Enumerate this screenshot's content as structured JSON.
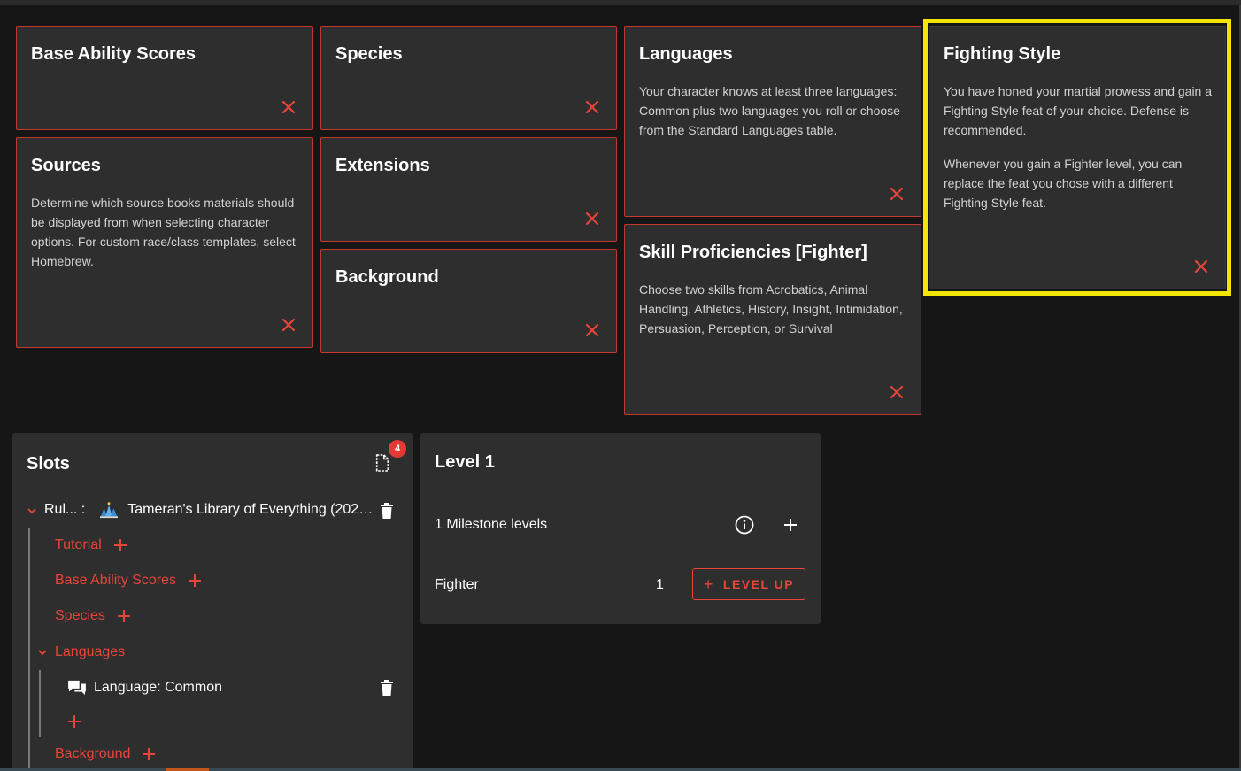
{
  "cards": {
    "base_ability": {
      "title": "Base Ability Scores"
    },
    "species": {
      "title": "Species"
    },
    "languages": {
      "title": "Languages",
      "desc": "Your character knows at least three languages: Common plus two languages you roll or choose from the Standard Languages table."
    },
    "fighting_style": {
      "title": "Fighting Style",
      "desc1": "You have honed your martial prowess and gain a Fighting Style feat of your choice. Defense is recommended.",
      "desc2": "Whenever you gain a Fighter level, you can replace the feat you chose with a different Fighting Style feat."
    },
    "sources": {
      "title": "Sources",
      "desc": "Determine which source books materials should be displayed from when selecting character options. For custom race/class templates, select Homebrew."
    },
    "extensions": {
      "title": "Extensions"
    },
    "background": {
      "title": "Background"
    },
    "skills": {
      "title": "Skill Proficiencies [Fighter]",
      "desc": "Choose two skills from Acrobatics, Animal Handling, Athletics, History, Insight, Intimidation, Persuasion, Perception, or Survival"
    }
  },
  "slots": {
    "title": "Slots",
    "badge": "4",
    "ruleset_label": "Rul... :",
    "ruleset_value": "Tameran's Library of Everything (2024...",
    "items": {
      "tutorial": "Tutorial",
      "base_ability": "Base Ability Scores",
      "species": "Species",
      "languages": "Languages",
      "language_common": "Language: Common",
      "background": "Background"
    }
  },
  "level": {
    "title": "Level 1",
    "milestone": "1 Milestone levels",
    "class_name": "Fighter",
    "class_level": "1",
    "level_up": "LEVEL UP"
  },
  "colors": {
    "accent": "#e8453a",
    "highlight": "#f4e500",
    "card_bg": "#2e2e2e",
    "page_bg": "#161616"
  }
}
